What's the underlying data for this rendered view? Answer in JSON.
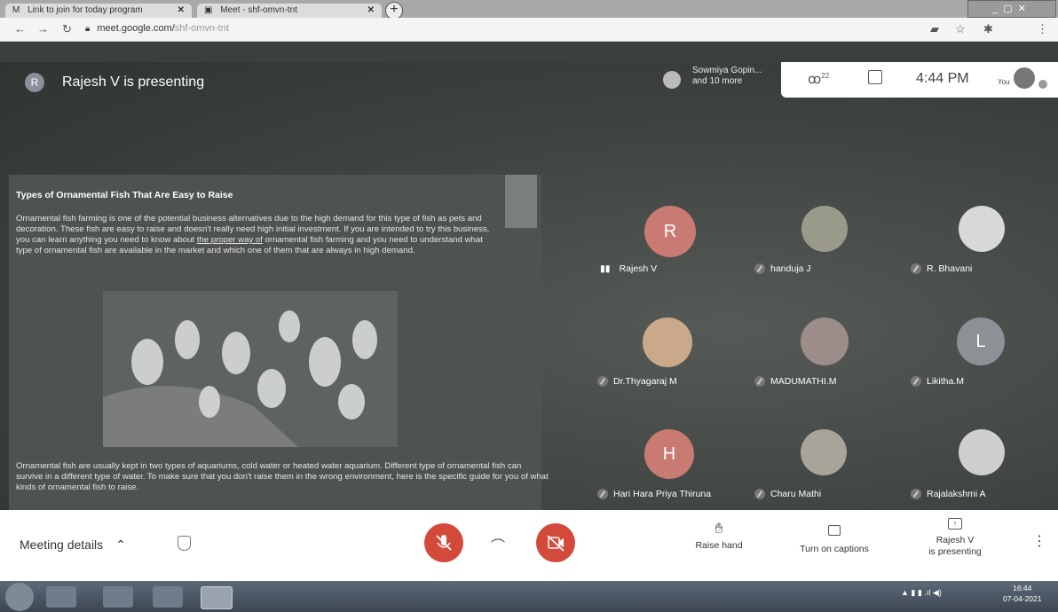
{
  "browser": {
    "tabs": [
      {
        "title": "Link to join for today program",
        "close": "✕"
      },
      {
        "title": "Meet - shf-omvn-tnt",
        "close": "✕"
      }
    ],
    "new_tab": "+",
    "url_host": "meet.google.com/",
    "url_path": "shf-omvn-tnt"
  },
  "meet": {
    "presenting_banner": "Rajesh V is presenting",
    "presenter_initial": "R",
    "others_line1": "Sowmiya Gopin...",
    "others_line2": "and 10 more",
    "people_count": "22",
    "time": "4:44 PM",
    "you_label": "You"
  },
  "slide": {
    "title": "Types of Ornamental Fish That Are Easy to Raise",
    "para1_a": "Ornamental fish farming is one of the potential business alternatives due to the high demand for this type of fish as pets and decoration. These fish are easy to raise and doesn't really need high initial investment. If you are intended to try this business, you can learn anything you need to know about ",
    "para1_link": "the proper way of",
    "para1_b": " ornamental fish farming and you need to understand what type of ornamental fish are available in the market and which one of them that are always in high demand.",
    "para2": "Ornamental fish are usually kept in two types of aquariums, cold water or heated water aquarium. Different type of ornamental fish can survive in a different type of water. To make sure that you don't raise them in the wrong environment, here is the specific guide for you of what kinds of ornamental fish to raise."
  },
  "participants": [
    {
      "name": "Rajesh V",
      "initial": "R",
      "color": "#c97a72"
    },
    {
      "name": "handuja J",
      "initial": "",
      "color": "#9a9a8a"
    },
    {
      "name": "R. Bhavani",
      "initial": "",
      "color": "#d8d8d8"
    },
    {
      "name": "Dr.Thyagaraj M",
      "initial": "",
      "color": "#caa98a"
    },
    {
      "name": "MADUMATHI.M",
      "initial": "",
      "color": "#9d8d8a"
    },
    {
      "name": "Likitha.M",
      "initial": "L",
      "color": "#8c9196"
    },
    {
      "name": "Hari Hara Priya Thiruna",
      "initial": "H",
      "color": "#c97a72"
    },
    {
      "name": "Charu Mathi",
      "initial": "",
      "color": "#a9a49a"
    },
    {
      "name": "Rajalakshmi A",
      "initial": "",
      "color": "#cfcfcf"
    }
  ],
  "controls": {
    "meeting_details": "Meeting details",
    "raise_hand": "Raise hand",
    "captions": "Turn on captions",
    "presenting_line1": "Rajesh V",
    "presenting_line2": "is presenting",
    "more": "⋮"
  },
  "taskbar": {
    "time": "16:44",
    "date": "07-04-2021"
  }
}
